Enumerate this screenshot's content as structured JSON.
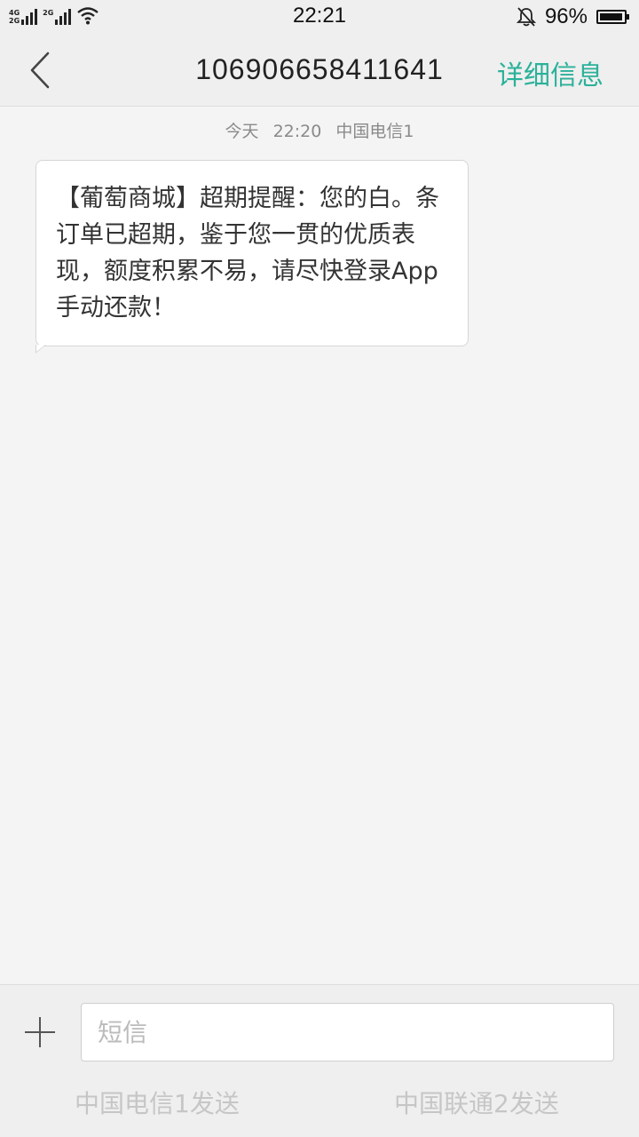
{
  "status_bar": {
    "time": "22:21",
    "battery_percent_text": "96%",
    "battery_level": 0.96,
    "sim1_labels": [
      "4G",
      "2G"
    ],
    "sim2_label": "2G",
    "icons": [
      "signal-icon",
      "wifi-icon",
      "bell-muted-icon",
      "battery-icon"
    ]
  },
  "header": {
    "title": "106906658411641",
    "details_label": "详细信息",
    "back_icon": "chevron-left-icon"
  },
  "message": {
    "day": "今天",
    "time": "22:20",
    "sim": "中国电信1",
    "text": "【葡萄商城】超期提醒：您的白。条订单已超期，鉴于您一贯的优质表现，额度积累不易，请尽快登录App手动还款！"
  },
  "composer": {
    "placeholder": "短信",
    "value": "",
    "send_sim1_label": "中国电信1发送",
    "send_sim2_label": "中国联通2发送",
    "plus_icon": "plus-icon"
  },
  "colors": {
    "accent": "#2bb19a",
    "background": "#f4f4f4",
    "bar": "#efefef"
  }
}
